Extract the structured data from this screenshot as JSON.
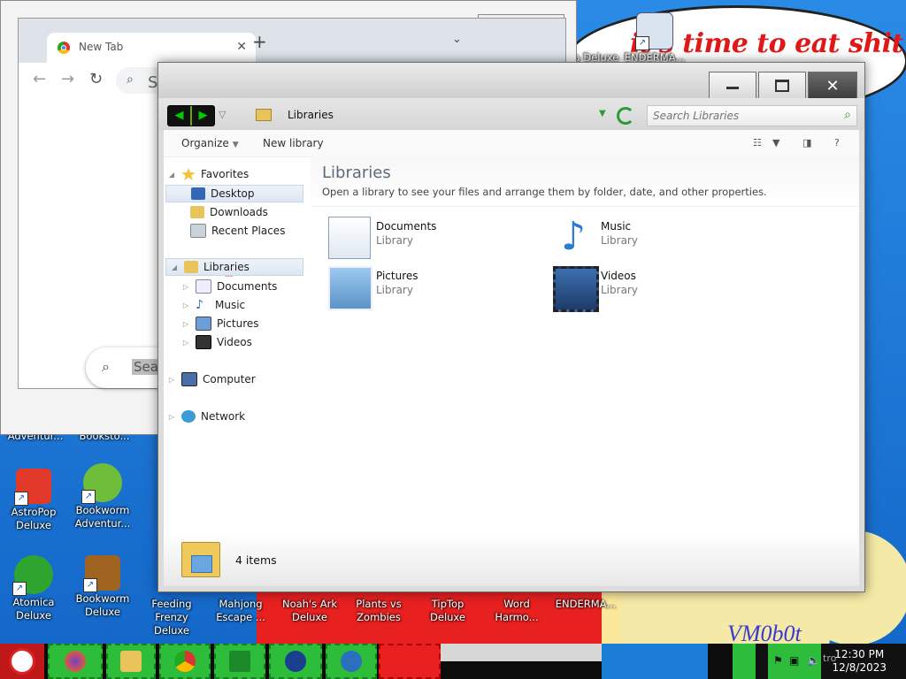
{
  "desktop": {
    "wallpaper_text": "it's time to eat shit",
    "watermark": "VM0b0t",
    "icons": [
      {
        "id": "atomica-top",
        "label": "Adventur..."
      },
      {
        "id": "bookstore",
        "label": "Booksto..."
      },
      {
        "id": "astropop",
        "label": "AstroPop Deluxe"
      },
      {
        "id": "bookworm-adv",
        "label": "Bookworm Adventur..."
      },
      {
        "id": "atomica",
        "label": "Atomica Deluxe"
      },
      {
        "id": "bookworm",
        "label": "Bookworm Deluxe"
      },
      {
        "id": "feeding-frenzy",
        "label": "Feeding Frenzy Deluxe"
      },
      {
        "id": "mahjong",
        "label": "Mahjong Escape ..."
      },
      {
        "id": "noahs-ark",
        "label": "Noah's Ark Deluxe"
      },
      {
        "id": "pvz",
        "label": "Plants vs Zombies"
      },
      {
        "id": "tiptop",
        "label": "TipTop Deluxe"
      },
      {
        "id": "word-harmony",
        "label": "Word Harmo..."
      },
      {
        "id": "enderman-bottom",
        "label": "ENDERMA..."
      },
      {
        "id": "adeluxe-top",
        "label": "a Deluxe"
      },
      {
        "id": "enderman-top",
        "label": "ENDERMA..."
      }
    ]
  },
  "chrome": {
    "tab_title": "New Tab",
    "omnibox_placeholder": "Se",
    "search_placeholder": "Sear"
  },
  "explorer": {
    "address": "Libraries",
    "search_placeholder": "Search Libraries",
    "toolbar": {
      "organize": "Organize",
      "new_library": "New library"
    },
    "nav": {
      "favorites": "Favorites",
      "desktop": "Desktop",
      "downloads": "Downloads",
      "recent": "Recent Places",
      "libraries": "Libraries",
      "documents": "Documents",
      "music": "Music",
      "pictures": "Pictures",
      "videos": "Videos",
      "computer": "Computer",
      "network": "Network"
    },
    "heading": "Libraries",
    "description": "Open a library to see your files and arrange them by folder, date, and other properties.",
    "items": [
      {
        "name": "Documents",
        "type": "Library",
        "icon": "documents-library-icon"
      },
      {
        "name": "Music",
        "type": "Library",
        "icon": "music-library-icon"
      },
      {
        "name": "Pictures",
        "type": "Library",
        "icon": "pictures-library-icon"
      },
      {
        "name": "Videos",
        "type": "Library",
        "icon": "videos-library-icon"
      }
    ],
    "status": "4 items"
  },
  "taskbar": {
    "time": "12:30 PM",
    "date": "12/8/2023",
    "tray_partial": "tro"
  },
  "colors": {
    "accent": "#2a9a3a",
    "taskbar_green": "#2ebd3a",
    "wallpaper_red": "#e82020"
  }
}
